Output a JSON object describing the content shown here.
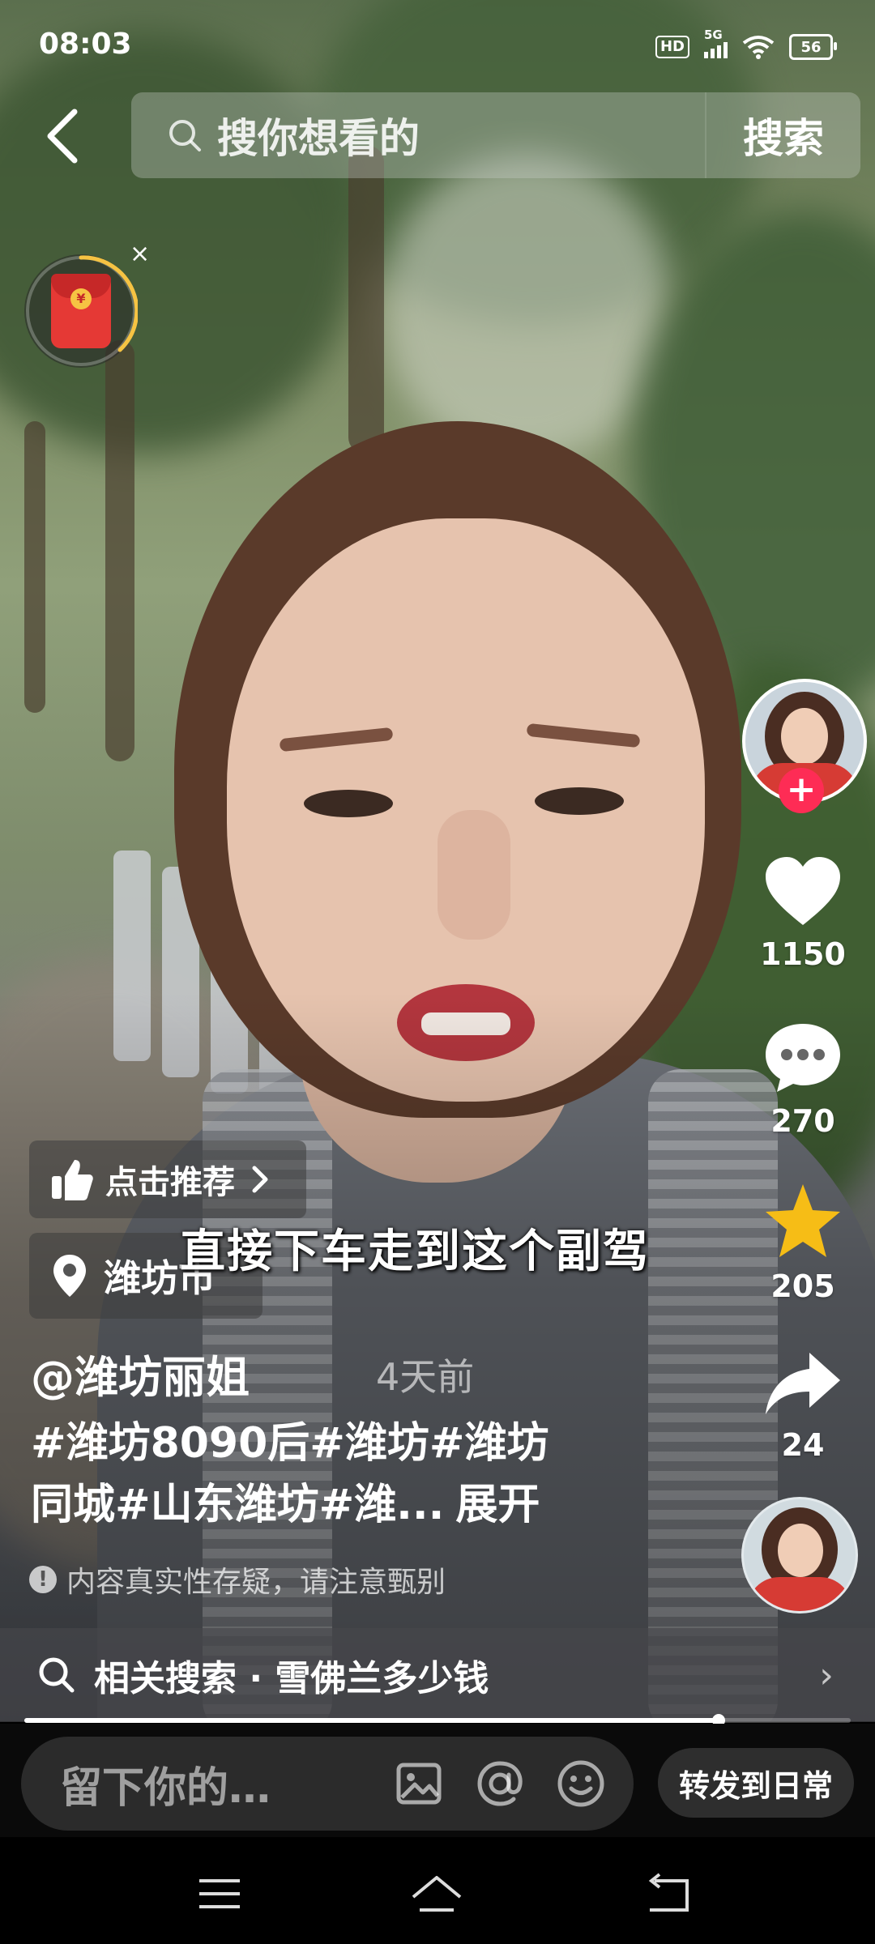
{
  "status_bar": {
    "time": "08:03",
    "network": "5G",
    "hd_label": "HD",
    "battery": "56"
  },
  "top_bar": {
    "search_placeholder": "搜你想看的",
    "search_button": "搜索"
  },
  "red_packet": {
    "coin_symbol": "¥",
    "close_symbol": "×"
  },
  "side_actions": {
    "like_count": "1150",
    "comment_count": "270",
    "favorite_count": "205",
    "share_count": "24",
    "follow_symbol": "+"
  },
  "video": {
    "subtitle": "直接下车走到这个副驾",
    "recommend_label": "点击推荐",
    "location": "潍坊市",
    "author": "@潍坊丽姐",
    "time_ago": "4天前",
    "description_line1": "#潍坊8090后#潍坊#潍坊",
    "description_line2": "同城#山东潍坊#潍...",
    "expand_label": "展开",
    "warning": "内容真实性存疑，请注意甄别",
    "warning_icon": "!",
    "progress": 0.84
  },
  "related_search": {
    "label": "相关搜索 · 雪佛兰多少钱",
    "arrow": "›"
  },
  "comment_bar": {
    "placeholder": "留下你的…",
    "share_daily": "转发到日常"
  },
  "colors": {
    "accent_red": "#fe2c55",
    "star_yellow": "#f6bd16",
    "red_packet": "#e53935"
  },
  "icons": [
    "back-icon",
    "search-icon",
    "red-packet-icon",
    "heart-icon",
    "comment-icon",
    "star-icon",
    "share-icon",
    "thumbs-up-icon",
    "location-pin-icon",
    "image-icon",
    "at-icon",
    "emoji-icon",
    "menu-icon",
    "home-icon",
    "back-nav-icon"
  ]
}
